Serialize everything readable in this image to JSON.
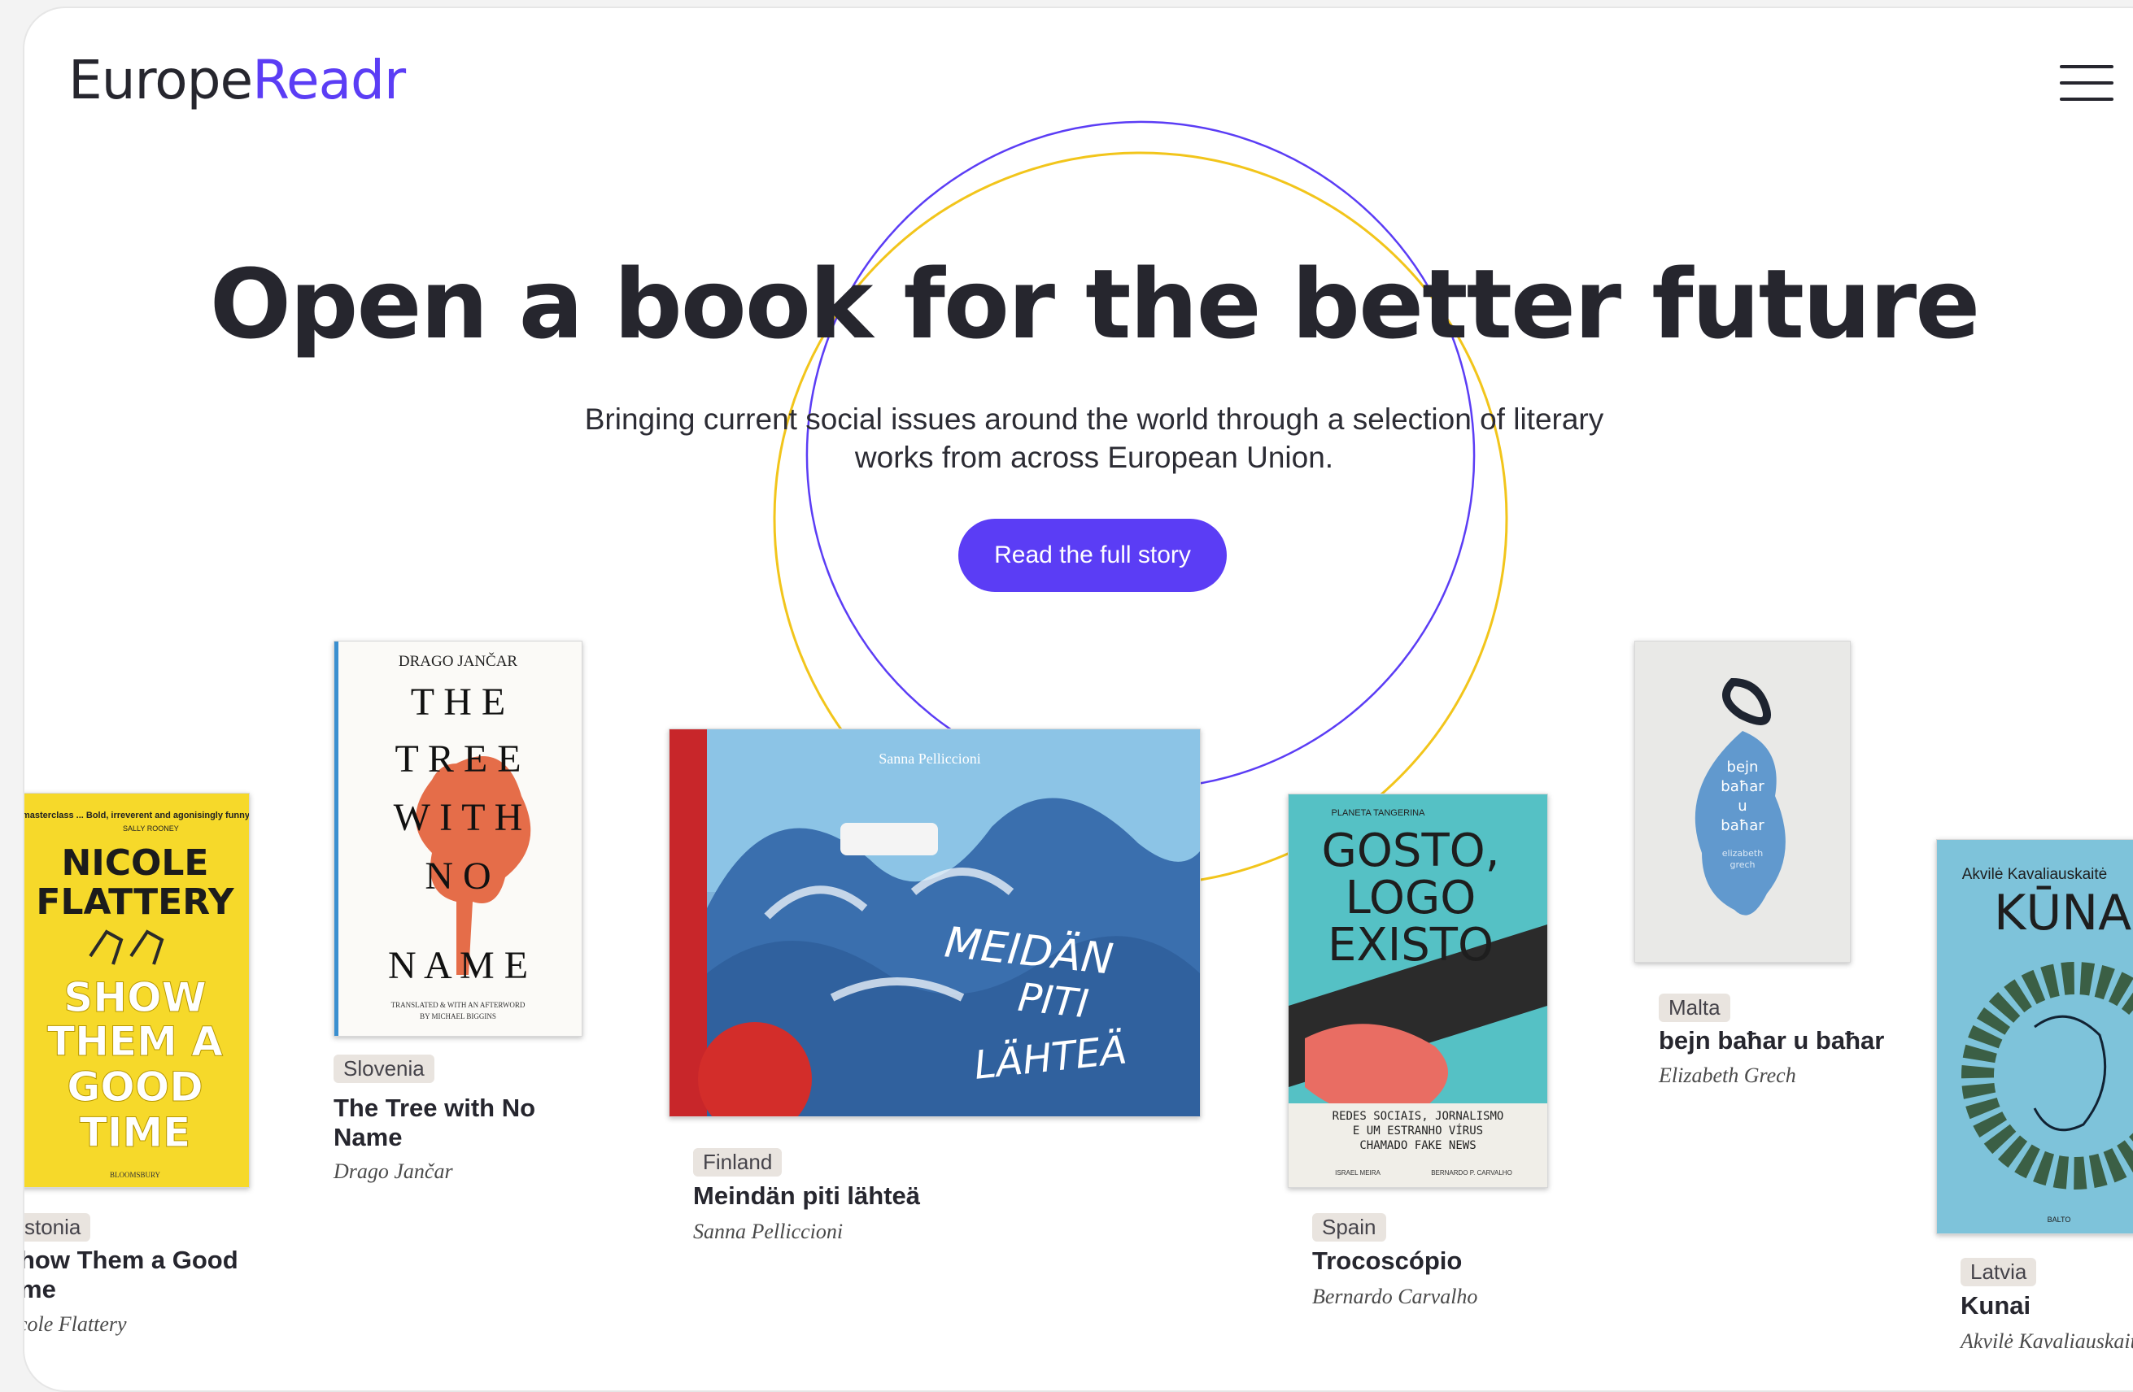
{
  "brand": {
    "name_part1": "Europe",
    "name_part2": "Readr",
    "accent_color": "#5b3df5"
  },
  "hero": {
    "headline": "Open a book for the better future",
    "subtitle": "Bringing current social issues around the world through a selection of literary works from across European Union.",
    "cta_label": "Read the full story"
  },
  "icons": {
    "menu": "hamburger-menu-icon"
  },
  "books": [
    {
      "country": "stonia",
      "title": "how Them a Good me",
      "author": "cole Flattery",
      "cover": {
        "top_text": "masterclass ... Bold, irreverent and agonisingly funny'",
        "sub_top": "SALLY ROONEY",
        "author_line1": "NICOLE",
        "author_line2": "FLATTERY",
        "title_lines": [
          "SHOW",
          "THEM A",
          "GOOD",
          "TIME"
        ],
        "publisher": "BLOOMSBURY"
      }
    },
    {
      "country": "Slovenia",
      "title": "The Tree with No Name",
      "author": "Drago Jančar",
      "cover": {
        "author": "DRAGO JANČAR",
        "word1": "T H E",
        "word2": "T R E E",
        "word3": "W I T H",
        "word4": "N O",
        "word5": "N A M E",
        "credit1": "TRANSLATED & WITH AN AFTERWORD",
        "credit2": "BY MICHAEL BIGGINS"
      }
    },
    {
      "country": "Finland",
      "title": "Meindän piti lähteä",
      "author": "Sanna Pelliccioni",
      "cover": {
        "author": "Sanna Pelliccioni",
        "line1": "MEIDÄN",
        "line2": "PITI",
        "line3": "LÄHTEÄ"
      }
    },
    {
      "country": "Spain",
      "title": "Trocoscópio",
      "author": "Bernardo Carvalho",
      "cover": {
        "publisher": "PLANETA TANGERINA",
        "title_lines": [
          "GOSTO,",
          "LOGO",
          "EXISTO"
        ],
        "tag1": "REDES SOCIAIS, JORNALISMO",
        "tag2": "E UM ESTRANHO VÍRUS",
        "tag3": "CHAMADO FAKE NEWS",
        "credit_left": "ISRAEL MEIRA",
        "credit_right": "BERNARDO P. CARVALHO"
      }
    },
    {
      "country": "Malta",
      "title": "bejn baħar u baħar",
      "author": "Elizabeth Grech",
      "cover": {
        "l1": "bejn",
        "l2": "baħar",
        "l3": "u",
        "l4": "baħar",
        "l5": "elizabeth",
        "l6": "grech"
      }
    },
    {
      "country": "Latvia",
      "title": "Kunai",
      "author": "Akvilė Kavaliauskaitė",
      "cover": {
        "author": "Akvilė Kavaliauskaitė",
        "title": "KŪNAI",
        "publisher": "BALTO"
      }
    }
  ]
}
